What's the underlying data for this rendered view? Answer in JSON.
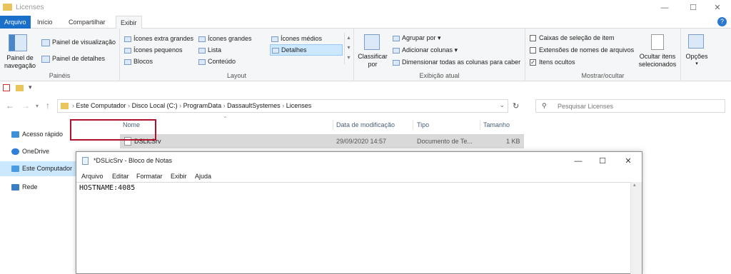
{
  "window": {
    "title": "Licenses",
    "minimize": "—",
    "maximize": "☐",
    "close": "✕"
  },
  "tabs": [
    {
      "label": "Arquivo"
    },
    {
      "label": "Início"
    },
    {
      "label": "Compartilhar"
    },
    {
      "label": "Exibir"
    }
  ],
  "help_label": "?",
  "ribbon": {
    "paineis": {
      "nav_pane_label_1": "Painel de",
      "nav_pane_label_2": "navegação",
      "preview_label": "Painel de visualização",
      "details_label": "Painel de detalhes",
      "group_label": "Painéis"
    },
    "layout": {
      "items": [
        "Ícones extra grandes",
        "Ícones grandes",
        "Ícones médios",
        "Ícones pequenos",
        "Lista",
        "Detalhes",
        "Blocos",
        "Conteúdo"
      ],
      "group_label": "Layout"
    },
    "current_view": {
      "sort_label_1": "Classificar",
      "sort_label_2": "por",
      "group_by": "Agrupar por",
      "add_columns": "Adicionar colunas",
      "fit_columns": "Dimensionar todas as colunas para caber",
      "group_label": "Exibição atual"
    },
    "show_hide": {
      "checkboxes": "Caixas de seleção de item",
      "extensions": "Extensões de nomes de arquivos",
      "hidden": "Itens ocultos",
      "hide_selected_1": "Ocultar itens",
      "hide_selected_2": "selecionados",
      "group_label": "Mostrar/ocultar"
    },
    "options_label": "Opções"
  },
  "address": {
    "path": [
      "Este Computador",
      "Disco Local (C:)",
      "ProgramData",
      "DassaultSystemes",
      "Licenses"
    ],
    "search_placeholder": "Pesquisar Licenses"
  },
  "nav_pane": [
    {
      "label": "Acesso rápido"
    },
    {
      "label": "OneDrive"
    },
    {
      "label": "Este Computador"
    },
    {
      "label": "Rede"
    }
  ],
  "file_list": {
    "columns": [
      "Nome",
      "Data de modificação",
      "Tipo",
      "Tamanho"
    ],
    "rows": [
      {
        "name": "DSLicSrv",
        "modified": "29/09/2020 14:57",
        "type": "Documento de Te...",
        "size": "1 KB"
      }
    ]
  },
  "notepad": {
    "title": "*DSLicSrv - Bloco de Notas",
    "menu": [
      "Arquivo",
      "Editar",
      "Formatar",
      "Exibir",
      "Ajuda"
    ],
    "content": "HOSTNAME:4085"
  },
  "colors": {
    "accent": "#1a6fc9",
    "highlight_box": "#b0112c",
    "selection": "#cce8ff"
  }
}
